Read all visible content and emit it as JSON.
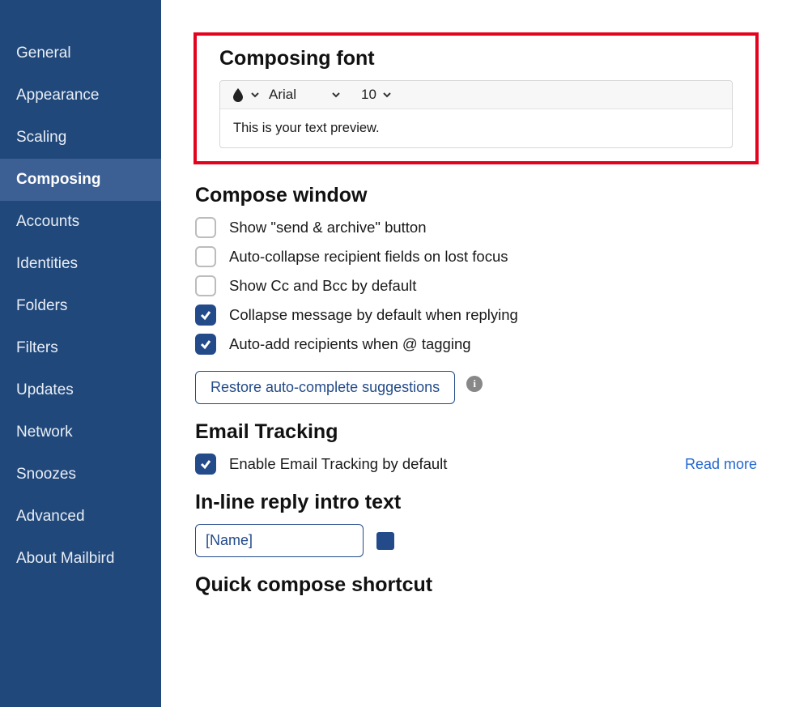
{
  "sidebar": {
    "items": [
      {
        "label": "General"
      },
      {
        "label": "Appearance"
      },
      {
        "label": "Scaling"
      },
      {
        "label": "Composing"
      },
      {
        "label": "Accounts"
      },
      {
        "label": "Identities"
      },
      {
        "label": "Folders"
      },
      {
        "label": "Filters"
      },
      {
        "label": "Updates"
      },
      {
        "label": "Network"
      },
      {
        "label": "Snoozes"
      },
      {
        "label": "Advanced"
      },
      {
        "label": "About Mailbird"
      }
    ],
    "active_index": 3
  },
  "composing_font": {
    "heading": "Composing font",
    "font_name": "Arial",
    "font_size": "10",
    "preview_text": "This is your text preview."
  },
  "compose_window": {
    "heading": "Compose window",
    "options": [
      {
        "label": "Show \"send & archive\" button",
        "checked": false
      },
      {
        "label": "Auto-collapse recipient fields on lost focus",
        "checked": false
      },
      {
        "label": "Show Cc and Bcc by default",
        "checked": false
      },
      {
        "label": "Collapse message by default when replying",
        "checked": true
      },
      {
        "label": "Auto-add recipients when @ tagging",
        "checked": true
      }
    ],
    "restore_button": "Restore auto-complete suggestions"
  },
  "email_tracking": {
    "heading": "Email Tracking",
    "option": {
      "label": "Enable Email Tracking by default",
      "checked": true
    },
    "read_more": "Read more"
  },
  "inline_reply": {
    "heading": "In-line reply intro text",
    "value": "[Name]",
    "color": "#234b8a"
  },
  "quick_compose": {
    "heading": "Quick compose shortcut"
  }
}
